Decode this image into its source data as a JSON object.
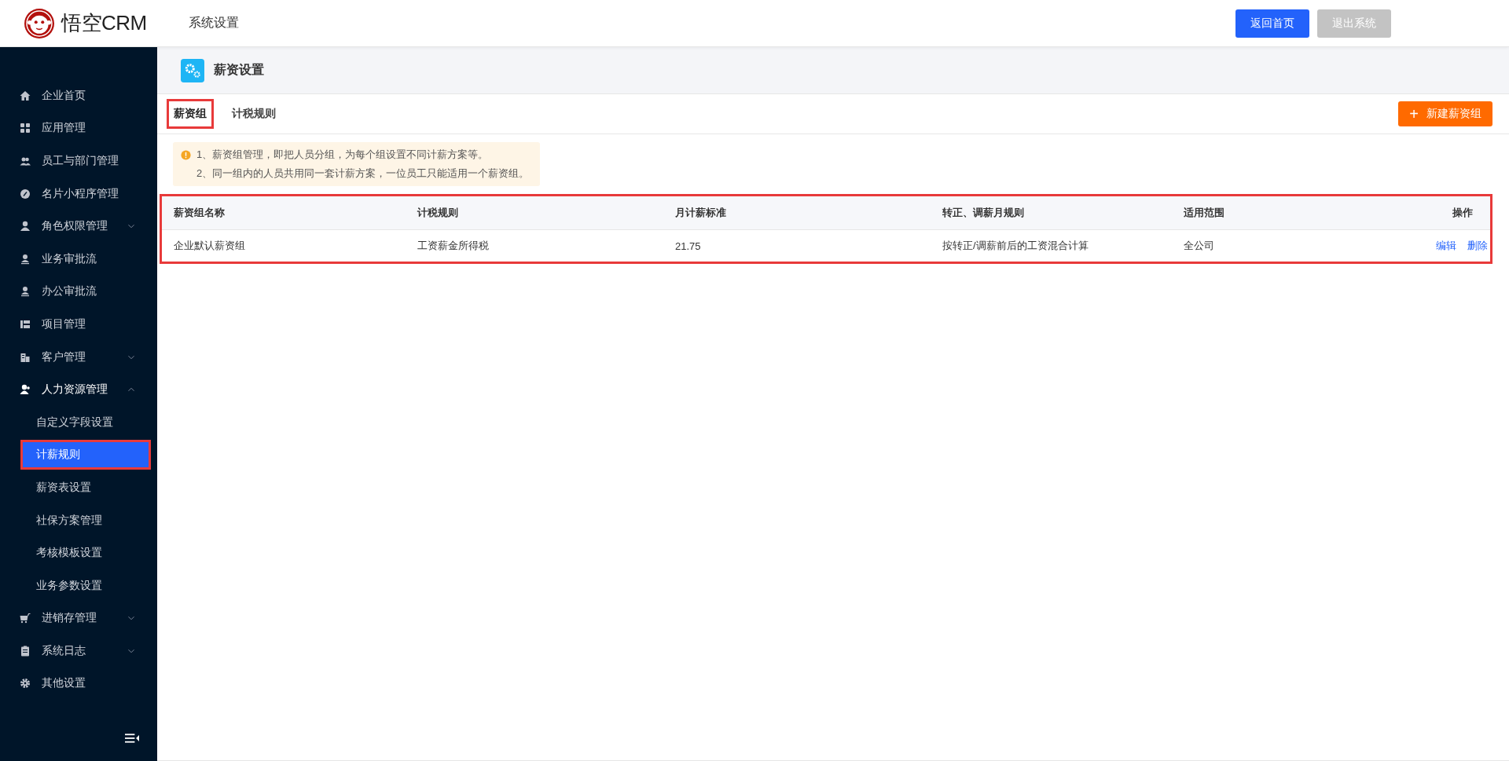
{
  "topbar": {
    "brand": "悟空CRM",
    "title": "系统设置",
    "buttons": [
      {
        "label": "返回首页",
        "kind": "primary"
      },
      {
        "label": "退出系统",
        "kind": "muted"
      }
    ]
  },
  "sidebar": {
    "items": [
      {
        "label": "企业首页"
      },
      {
        "label": "应用管理"
      },
      {
        "label": "员工与部门管理"
      },
      {
        "label": "名片小程序管理"
      },
      {
        "label": "角色权限管理",
        "expanded": false
      },
      {
        "label": "业务审批流"
      },
      {
        "label": "办公审批流"
      },
      {
        "label": "项目管理"
      },
      {
        "label": "客户管理",
        "expanded": false
      },
      {
        "label": "人力资源管理",
        "expanded": true,
        "children": [
          {
            "label": "自定义字段设置",
            "selected": false
          },
          {
            "label": "计薪规则",
            "selected": true
          },
          {
            "label": "薪资表设置",
            "selected": false
          },
          {
            "label": "社保方案管理",
            "selected": false
          },
          {
            "label": "考核模板设置",
            "selected": false
          },
          {
            "label": "业务参数设置",
            "selected": false
          }
        ]
      },
      {
        "label": "进销存管理",
        "expanded": false
      },
      {
        "label": "系统日志",
        "expanded": false
      },
      {
        "label": "其他设置"
      }
    ]
  },
  "page": {
    "title": "薪资设置",
    "tabs": [
      {
        "label": "薪资组",
        "selected": true
      },
      {
        "label": "计税规则",
        "selected": false
      }
    ],
    "add_button": {
      "icon": "+",
      "label": "新建薪资组"
    },
    "notice": [
      "1、薪资组管理，即把人员分组，为每个组设置不同计薪方案等。",
      "2、同一组内的人员共用同一套计薪方案，一位员工只能适用一个薪资组。"
    ],
    "table": {
      "columns": [
        "薪资组名称",
        "计税规则",
        "月计薪标准",
        "转正、调薪月规则",
        "适用范围",
        "操作"
      ],
      "rows": [
        {
          "cells": [
            "企业默认薪资组",
            "工资薪金所得税",
            "21.75",
            "按转正/调薪前后的工资混合计算",
            "全公司"
          ],
          "actions": [
            "编辑",
            "删除"
          ]
        }
      ]
    }
  }
}
